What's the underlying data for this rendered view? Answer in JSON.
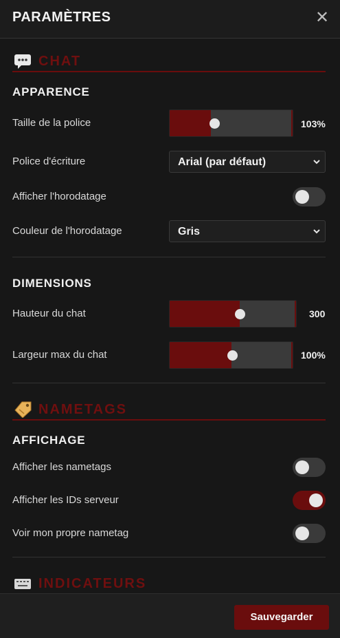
{
  "header": {
    "title": "PARAMÈTRES",
    "close_label": "✕"
  },
  "chat": {
    "title": "CHAT",
    "icon": "chat-bubble-icon",
    "apparence": {
      "title": "APPARENCE",
      "font_size": {
        "label": "Taille de la police",
        "value": "103%",
        "fraction": 0.3
      },
      "font_family": {
        "label": "Police d'écriture",
        "value": "Arial (par défaut)"
      },
      "show_timestamp": {
        "label": "Afficher l'horodatage",
        "on": false
      },
      "timestamp_color": {
        "label": "Couleur de l'horodatage",
        "value": "Gris"
      }
    },
    "dimensions": {
      "title": "DIMENSIONS",
      "height": {
        "label": "Hauteur du chat",
        "value": "300",
        "fraction": 0.55
      },
      "max_width": {
        "label": "Largeur max du chat",
        "value": "100%",
        "fraction": 0.5
      }
    }
  },
  "nametags": {
    "title": "NAMETAGS",
    "icon": "tag-icon",
    "affichage": {
      "title": "AFFICHAGE",
      "show_nametags": {
        "label": "Afficher les nametags",
        "on": false
      },
      "show_server_ids": {
        "label": "Afficher les IDs serveur",
        "on": true
      },
      "see_own_nametag": {
        "label": "Voir mon propre nametag",
        "on": false
      }
    }
  },
  "indicateurs": {
    "title": "INDICATEURS",
    "icon": "keyboard-icon"
  },
  "footer": {
    "save_label": "Sauvegarder"
  },
  "colors": {
    "accent": "#6a0d0d",
    "background": "#171717",
    "text": "#e6e6e6"
  }
}
